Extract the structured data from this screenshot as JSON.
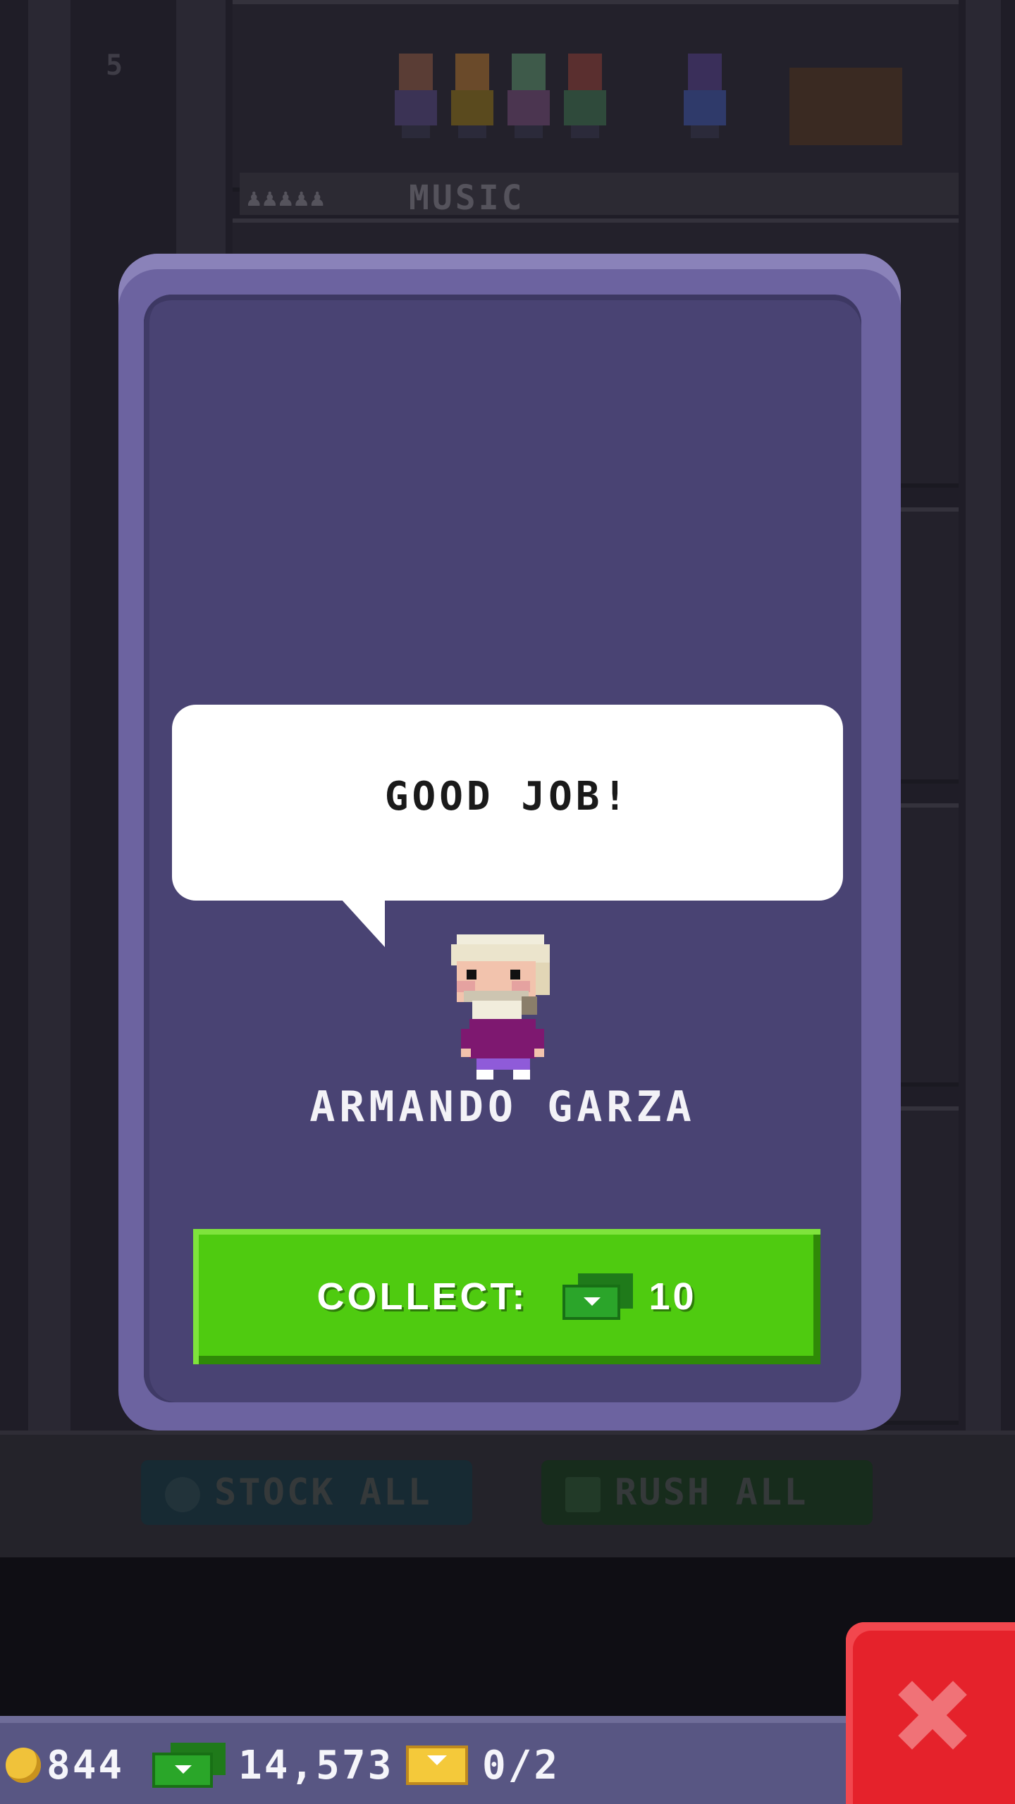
{
  "background": {
    "floor_name": "MUSIC",
    "floor_level": "5",
    "stock_all_label": "STOCK ALL",
    "rush_all_label": "RUSH ALL"
  },
  "dialog": {
    "speech": "GOOD JOB!",
    "character_name": "ARMANDO GARZA",
    "collect_label": "COLLECT:",
    "collect_amount": "10",
    "collect_currency_icon": "bux-icon"
  },
  "hud": {
    "coins": "844",
    "bux": "14,573",
    "tickets": "0/2",
    "coin_icon": "coin-icon",
    "bux_icon": "bux-icon",
    "ticket_icon": "golden-ticket-icon"
  },
  "close_icon": "close-icon",
  "colors": {
    "modal_border": "#6c63a0",
    "modal_fill": "#494373",
    "collect_green": "#4fcb10",
    "close_red": "#e5222b",
    "hud_bar": "#585683"
  }
}
